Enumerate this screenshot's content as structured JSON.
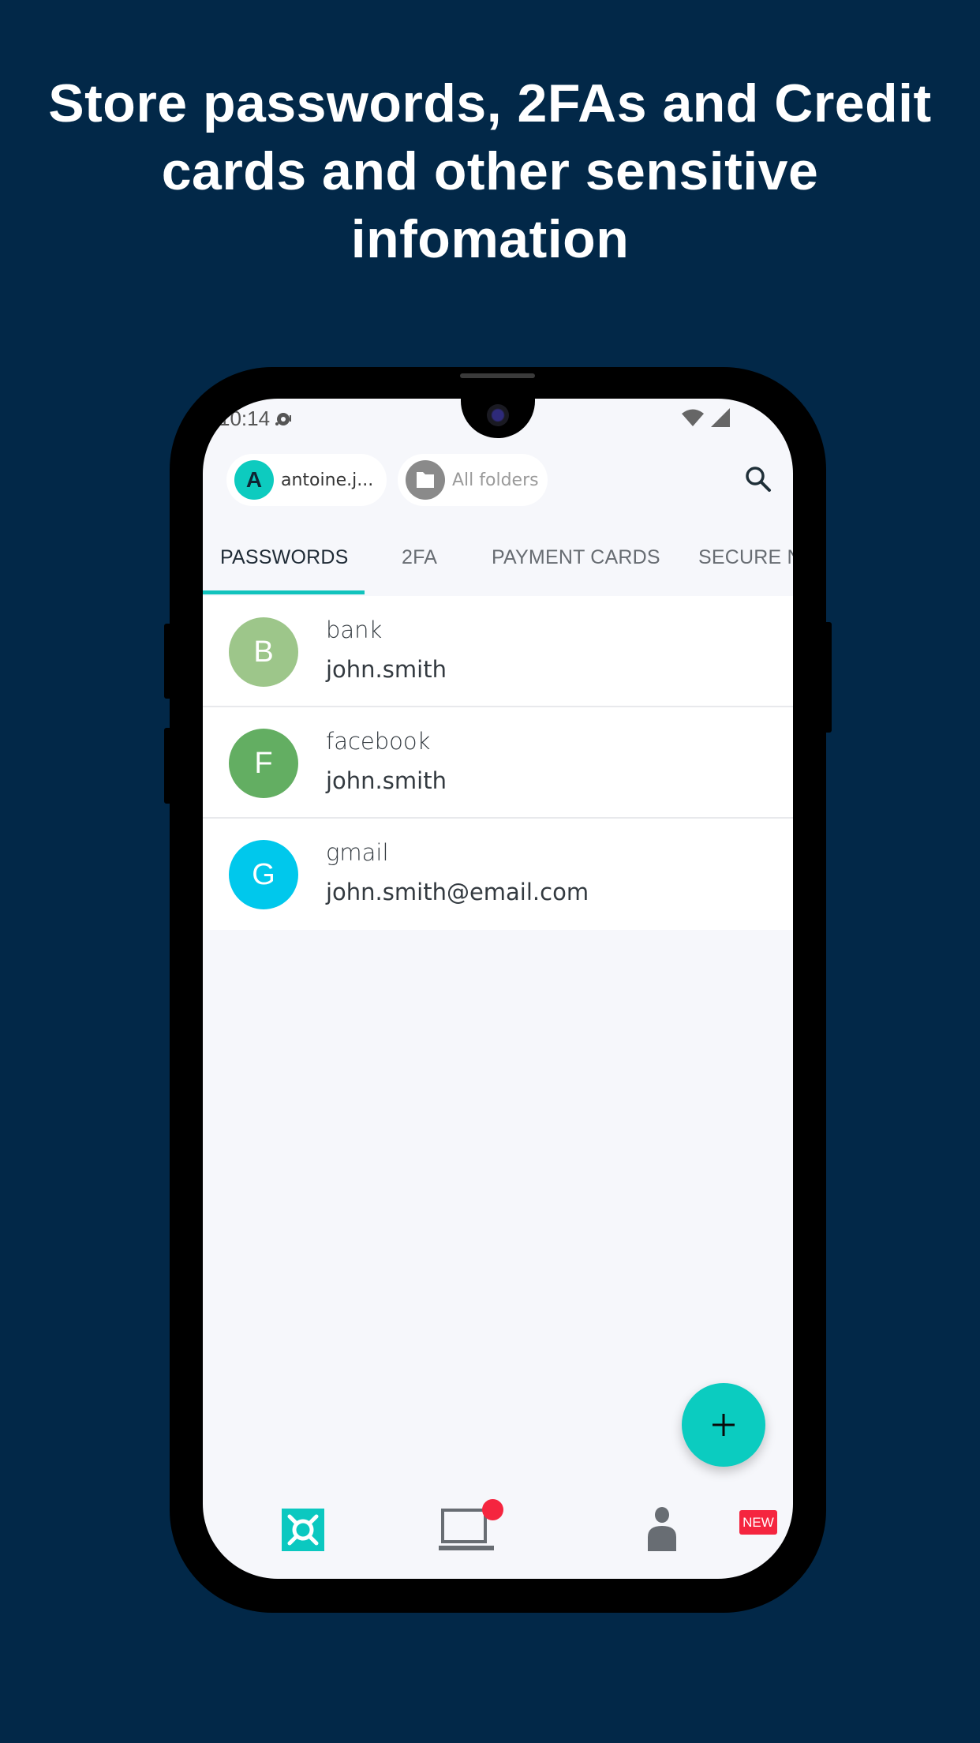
{
  "headline": "Store passwords, 2FAs and Credit cards and other sensitive infomation",
  "status_bar": {
    "time": "10:14",
    "icons": [
      "notification-icon",
      "wifi-icon",
      "cellular-signal-icon"
    ]
  },
  "header": {
    "account_chip": {
      "initial": "A",
      "label": "antoine.j..."
    },
    "folder_chip": {
      "label": "All folders",
      "icon": "folder-icon"
    },
    "search_icon": "search-icon"
  },
  "tabs": [
    {
      "label": "PASSWORDS",
      "active": true
    },
    {
      "label": "2FA",
      "active": false
    },
    {
      "label": "PAYMENT CARDS",
      "active": false
    },
    {
      "label": "SECURE N",
      "active": false
    }
  ],
  "items": [
    {
      "initial": "B",
      "title": "bank",
      "subtitle": "john.smith",
      "color": "#9dc68a"
    },
    {
      "initial": "F",
      "title": "facebook",
      "subtitle": "john.smith",
      "color": "#63ae62"
    },
    {
      "initial": "G",
      "title": "gmail",
      "subtitle": "john.smith@email.com",
      "color": "#00c8ec"
    }
  ],
  "fab": {
    "label": "+",
    "icon": "add-icon"
  },
  "bottom_nav": [
    {
      "name": "vault",
      "icon": "vault-icon",
      "active": true
    },
    {
      "name": "devices",
      "icon": "laptop-icon",
      "has_dot_badge": true
    },
    {
      "name": "account",
      "icon": "person-icon",
      "badge": "NEW"
    }
  ],
  "colors": {
    "background": "#022848",
    "accent": "#0bccc0",
    "badge": "#f5253f",
    "screen_bg": "#f6f7fb"
  }
}
